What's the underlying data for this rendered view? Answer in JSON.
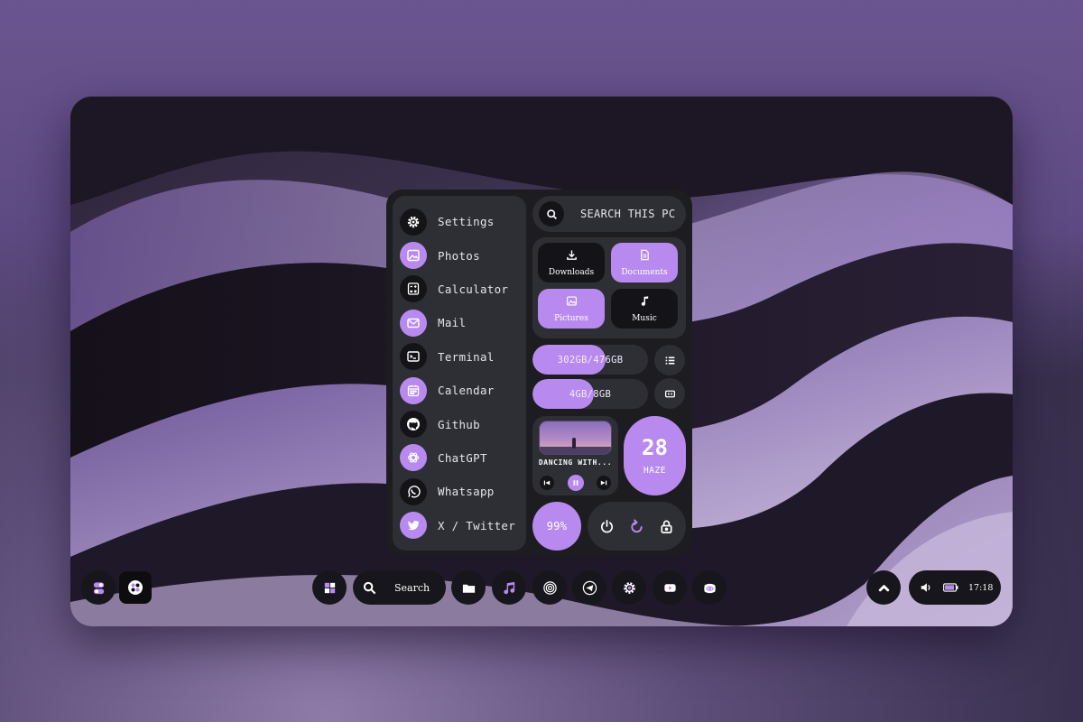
{
  "colors": {
    "accent": "#b88aef",
    "panel": "#1c1c21",
    "card": "#2e2e35",
    "dark": "#141418"
  },
  "start_menu": {
    "apps": [
      {
        "label": "Settings",
        "icon": "gear-icon",
        "style": "dark"
      },
      {
        "label": "Photos",
        "icon": "image-icon",
        "style": "light"
      },
      {
        "label": "Calculator",
        "icon": "calculator-icon",
        "style": "dark"
      },
      {
        "label": "Mail",
        "icon": "mail-icon",
        "style": "light"
      },
      {
        "label": "Terminal",
        "icon": "terminal-icon",
        "style": "dark"
      },
      {
        "label": "Calendar",
        "icon": "calendar-icon",
        "style": "light"
      },
      {
        "label": "Github",
        "icon": "github-icon",
        "style": "dark"
      },
      {
        "label": "ChatGPT",
        "icon": "chatgpt-icon",
        "style": "light"
      },
      {
        "label": "Whatsapp",
        "icon": "whatsapp-icon",
        "style": "dark"
      },
      {
        "label": "X / Twitter",
        "icon": "twitter-icon",
        "style": "light"
      }
    ],
    "search": {
      "label": "SEARCH THIS PC",
      "icon": "search-icon"
    },
    "folders": [
      {
        "label": "Downloads",
        "icon": "download-icon",
        "style": "dark"
      },
      {
        "label": "Documents",
        "icon": "document-icon",
        "style": "light"
      },
      {
        "label": "Pictures",
        "icon": "image-icon",
        "style": "light"
      },
      {
        "label": "Music",
        "icon": "music-note-icon",
        "style": "dark"
      }
    ],
    "storage": {
      "label": "302GB/476GB",
      "used_fraction": 0.63,
      "icon": "list-icon"
    },
    "memory": {
      "label": "4GB/8GB",
      "used_fraction": 0.53,
      "icon": "memory-chip-icon"
    },
    "media": {
      "title": "DANCING WITH...",
      "state": "playing"
    },
    "weather": {
      "temperature": "28",
      "condition": "HAZE"
    },
    "battery": {
      "label": "99%"
    },
    "power": [
      "power-icon",
      "restart-icon",
      "lock-icon"
    ]
  },
  "taskbar": {
    "left": [
      "toggle-icon",
      "app-launcher-icon"
    ],
    "search": {
      "label": "Search",
      "icon": "search-icon"
    },
    "pinned": [
      "windows-icon",
      "folder-icon",
      "music-icon",
      "target-icon",
      "telegram-icon",
      "gear-icon",
      "youtube-icon",
      "discord-icon"
    ],
    "tray": {
      "time": "17:18",
      "volume_icon": "volume-icon",
      "battery_icon": "battery-icon",
      "chevron_icon": "chevron-up-icon"
    }
  }
}
